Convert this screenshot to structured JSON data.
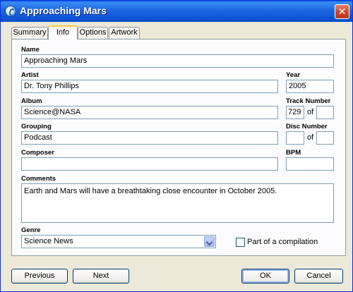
{
  "window": {
    "title": "Approaching Mars",
    "close_label": "✕"
  },
  "tabs": [
    {
      "label": "Summary"
    },
    {
      "label": "Info",
      "active": true
    },
    {
      "label": "Options"
    },
    {
      "label": "Artwork"
    }
  ],
  "fields": {
    "name": {
      "label": "Name",
      "value": "Approaching Mars"
    },
    "artist": {
      "label": "Artist",
      "value": "Dr. Tony Phillips"
    },
    "year": {
      "label": "Year",
      "value": "2005"
    },
    "album": {
      "label": "Album",
      "value": "Science@NASA"
    },
    "track_number": {
      "label": "Track Number",
      "value": "729",
      "of_label": "of",
      "total": ""
    },
    "grouping": {
      "label": "Grouping",
      "value": "Podcast"
    },
    "disc_number": {
      "label": "Disc Number",
      "value": "",
      "of_label": "of",
      "total": ""
    },
    "composer": {
      "label": "Composer",
      "value": ""
    },
    "bpm": {
      "label": "BPM",
      "value": ""
    },
    "comments": {
      "label": "Comments",
      "value": "Earth and Mars will have a breathtaking close encounter in October 2005."
    },
    "genre": {
      "label": "Genre",
      "value": "Science News"
    },
    "compilation": {
      "label": "Part of a compilation",
      "checked": false
    }
  },
  "buttons": {
    "previous": "Previous",
    "next": "Next",
    "ok": "OK",
    "cancel": "Cancel"
  },
  "colors": {
    "titlebar": "#0a5fe6",
    "face": "#ece9d8",
    "active_tab_accent": "#ffc83c"
  }
}
